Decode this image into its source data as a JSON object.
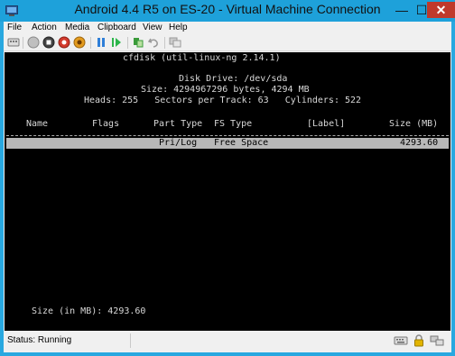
{
  "window": {
    "title": "Android 4.4 R5 on ES-20 - Virtual Machine Connection",
    "minimize_glyph": "—",
    "maximize_glyph": "☐",
    "close_glyph": "✕"
  },
  "menu": [
    "File",
    "Action",
    "Media",
    "Clipboard",
    "View",
    "Help"
  ],
  "toolbar": {
    "icons": [
      "ctrl-alt-del-icon",
      "start-icon",
      "turn-off-icon",
      "shutdown-icon",
      "save-icon",
      "pause-icon",
      "resume-icon",
      "checkpoint-icon",
      "revert-icon",
      "enhanced-session-icon"
    ]
  },
  "console": {
    "program": "cfdisk (util-linux-ng 2.14.1)",
    "disk_drive": "Disk Drive: /dev/sda",
    "size_line": "Size: 4294967296 bytes, 4294 MB",
    "geometry_line": "Heads: 255   Sectors per Track: 63   Cylinders: 522",
    "columns": {
      "name": "Name",
      "flags": "Flags",
      "part_type": "Part Type",
      "fs_type": "FS Type",
      "label": "[Label]",
      "size": "Size (MB)"
    },
    "row": {
      "part_type": "Pri/Log",
      "fs_type": "Free Space",
      "size": "4293.60"
    },
    "prompt": "Size (in MB): 4293.60"
  },
  "status": {
    "text": "Status: Running",
    "icons": [
      "keyboard-icon",
      "lock-icon",
      "network-icon"
    ]
  }
}
